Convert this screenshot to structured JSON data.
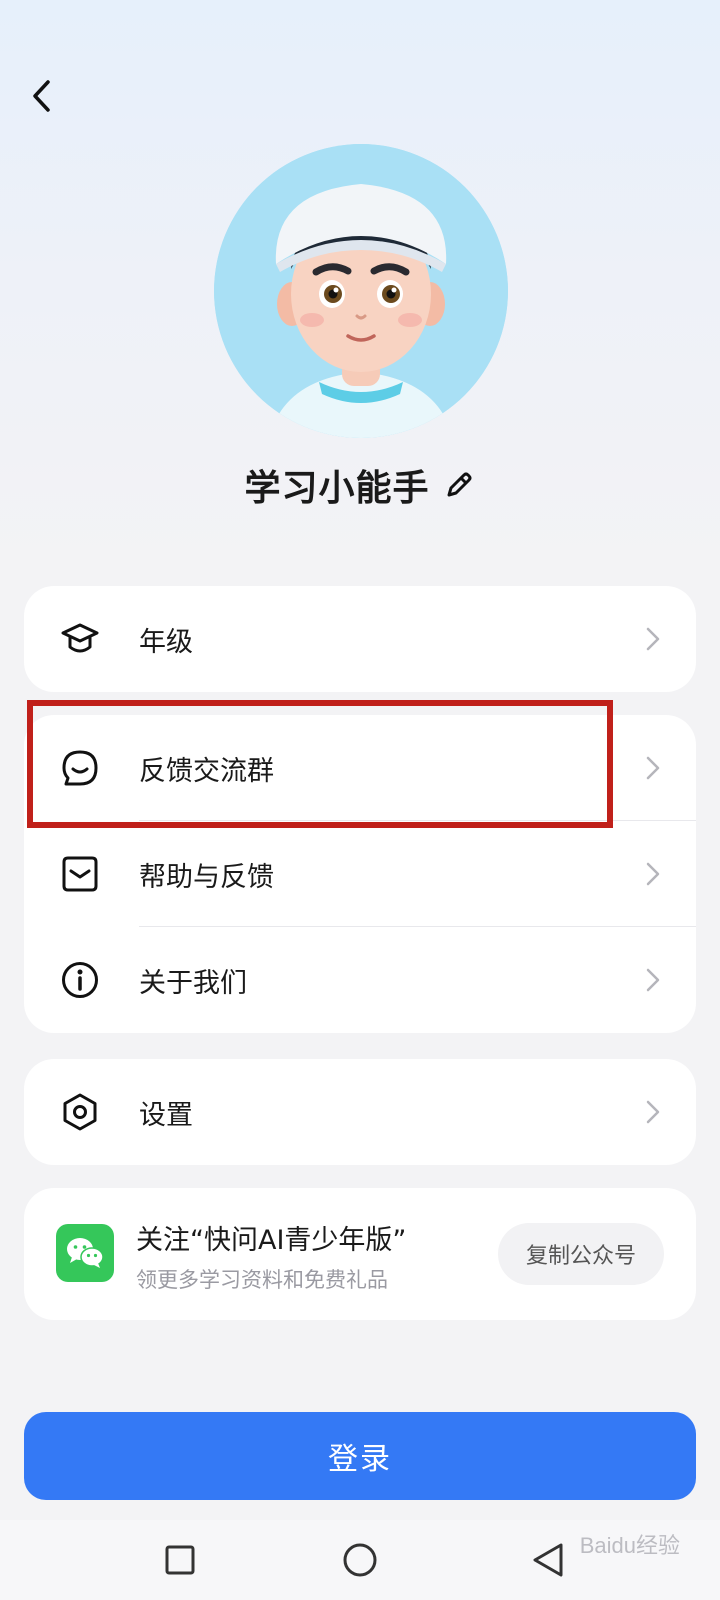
{
  "header": {
    "back_icon": "chevron-left-icon"
  },
  "profile": {
    "username": "学习小能手",
    "edit_icon": "pencil-icon",
    "avatar": "cartoon-boy-avatar"
  },
  "menu": {
    "grade": {
      "label": "年级",
      "icon": "graduation-cap-icon"
    },
    "feedback_group": {
      "label": "反馈交流群",
      "icon": "chat-smile-icon"
    },
    "help": {
      "label": "帮助与反馈",
      "icon": "help-mail-icon"
    },
    "about": {
      "label": "关于我们",
      "icon": "info-icon"
    },
    "settings": {
      "label": "设置",
      "icon": "hexagon-gear-icon"
    }
  },
  "wechat": {
    "title": "关注“快问AI青少年版”",
    "subtitle": "领更多学习资料和免费礼品",
    "copy_label": "复制公众号",
    "logo": "wechat-icon"
  },
  "login": {
    "label": "登录"
  },
  "colors": {
    "accent": "#3479f5",
    "highlight": "#c0201a",
    "wechat": "#35c75a"
  },
  "watermark": "Baidu经验"
}
